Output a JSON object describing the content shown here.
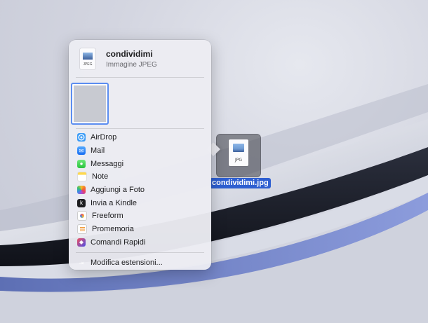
{
  "share_sheet": {
    "file_name": "condividimi",
    "file_kind": "Immagine JPEG",
    "doc_icon_ext": "JPEG",
    "items": [
      {
        "label": "AirDrop",
        "icon": "airdrop-icon"
      },
      {
        "label": "Mail",
        "icon": "mail-icon"
      },
      {
        "label": "Messaggi",
        "icon": "messages-icon"
      },
      {
        "label": "Note",
        "icon": "notes-icon"
      },
      {
        "label": "Aggiungi a Foto",
        "icon": "photos-icon"
      },
      {
        "label": "Invia a Kindle",
        "icon": "kindle-icon"
      },
      {
        "label": "Freeform",
        "icon": "freeform-icon"
      },
      {
        "label": "Promemoria",
        "icon": "reminders-icon"
      },
      {
        "label": "Comandi Rapidi",
        "icon": "shortcuts-icon"
      }
    ],
    "edit_extensions": "Modifica estensioni..."
  },
  "desktop": {
    "file_label": "condividimi.jpg",
    "file_icon_ext": "JPG",
    "selection_color": "#2e5fd1"
  }
}
